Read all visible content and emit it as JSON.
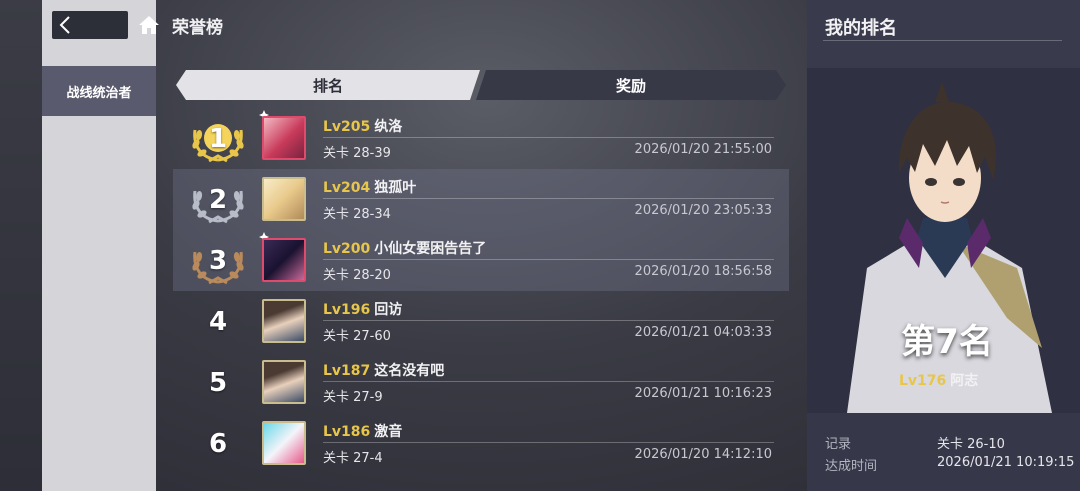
{
  "header": {
    "title": "荣誉榜"
  },
  "sidebar": {
    "active_tab": "战线统治者"
  },
  "tabs": {
    "rank": "排名",
    "reward": "奖励"
  },
  "rows": [
    {
      "rank": "1",
      "lv": "Lv205",
      "name": "纨洛",
      "stage": "关卡 28-39",
      "time": "2026/01/20 21:55:00"
    },
    {
      "rank": "2",
      "lv": "Lv204",
      "name": "独孤叶",
      "stage": "关卡 28-34",
      "time": "2026/01/20 23:05:33"
    },
    {
      "rank": "3",
      "lv": "Lv200",
      "name": "小仙女要困告告了",
      "stage": "关卡 28-20",
      "time": "2026/01/20 18:56:58"
    },
    {
      "rank": "4",
      "lv": "Lv196",
      "name": "回访",
      "stage": "关卡 27-60",
      "time": "2026/01/21 04:03:33"
    },
    {
      "rank": "5",
      "lv": "Lv187",
      "name": "这名没有吧",
      "stage": "关卡 27-9",
      "time": "2026/01/21 10:16:23"
    },
    {
      "rank": "6",
      "lv": "Lv186",
      "name": "激音",
      "stage": "关卡 27-4",
      "time": "2026/01/20 14:12:10"
    }
  ],
  "my_rank": {
    "title": "我的排名",
    "rank_text": "第7名",
    "lv": "Lv176",
    "name": "阿志",
    "record_label": "记录",
    "record_value": "关卡 26-10",
    "time_label": "达成时间",
    "time_value": "2026/01/21 10:19:15"
  },
  "colors": {
    "gold": "#e8c64a",
    "silver": "#b8bcc8",
    "bronze": "#b88a5c",
    "accent": "#e8c64a"
  },
  "icons": [
    "back-icon",
    "home-icon",
    "laurel-wreath-icon",
    "character-avatar-icon"
  ]
}
